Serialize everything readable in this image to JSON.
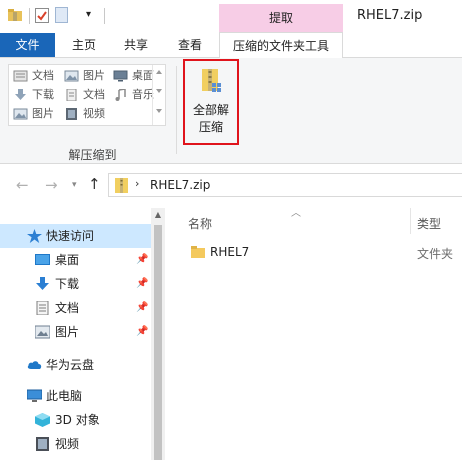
{
  "window": {
    "title": "RHEL7.zip",
    "context_group": "提取"
  },
  "ribbon_tabs": {
    "file": "文件",
    "home": "主页",
    "share": "共享",
    "view": "查看",
    "compressed_tools": "压缩的文件夹工具"
  },
  "ribbon": {
    "places": [
      {
        "label": "文档",
        "icon": "documents-icon"
      },
      {
        "label": "图片",
        "icon": "pictures-icon"
      },
      {
        "label": "桌面",
        "icon": "desktop-icon"
      },
      {
        "label": "下载",
        "icon": "download-icon"
      },
      {
        "label": "文档",
        "icon": "documents-icon"
      },
      {
        "label": "音乐",
        "icon": "music-icon"
      },
      {
        "label": "图片",
        "icon": "pictures-icon"
      },
      {
        "label": "视频",
        "icon": "video-icon"
      }
    ],
    "group_label": "解压缩到",
    "extract_all_line1": "全部解",
    "extract_all_line2": "压缩"
  },
  "address_bar": {
    "path": "RHEL7.zip"
  },
  "nav_pane": {
    "quick_access": "快速访问",
    "desktop": "桌面",
    "downloads": "下载",
    "documents": "文档",
    "pictures": "图片",
    "huawei_cloud": "华为云盘",
    "this_pc": "此电脑",
    "objects_3d": "3D 对象",
    "videos": "视频"
  },
  "file_list": {
    "columns": {
      "name": "名称",
      "type": "类型"
    },
    "rows": [
      {
        "name": "RHEL7",
        "type": "文件夹"
      }
    ]
  },
  "colors": {
    "file_tab": "#1a66b8",
    "context_tab": "#f7cde6",
    "highlight_border": "#e0141c",
    "selected_nav": "#cde8ff"
  }
}
